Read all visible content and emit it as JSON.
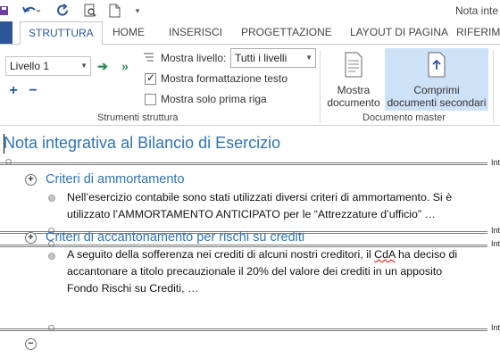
{
  "qat": {
    "doc_title": "Nota inte"
  },
  "tabs": [
    {
      "label": "STRUTTURA",
      "active": true
    },
    {
      "label": "HOME"
    },
    {
      "label": "INSERISCI"
    },
    {
      "label": "PROGETTAZIONE"
    },
    {
      "label": "LAYOUT DI PAGINA"
    },
    {
      "label": "RIFERIM"
    }
  ],
  "ribbon": {
    "outline_tools": {
      "level_value": "Livello 1",
      "show_level_label": "Mostra livello:",
      "show_level_value": "Tutti i livelli",
      "show_text_formatting_label": "Mostra formattazione testo",
      "show_text_formatting_checked": true,
      "show_first_line_label": "Mostra solo prima riga",
      "show_first_line_checked": false,
      "group_label": "Strumenti struttura"
    },
    "master_document": {
      "show_document_line1": "Mostra",
      "show_document_line2": "documento",
      "collapse_subdocs_line1": "Comprimi",
      "collapse_subdocs_line2": "documenti secondari",
      "group_label": "Documento master"
    }
  },
  "document": {
    "title": "Nota integrativa al Bilancio di Esercizio",
    "section_break_label": "Int",
    "sections": [
      {
        "heading": "Criteri di ammortamento",
        "body_line1": "Nell’esercizio contabile sono stati utilizzati diversi criteri di ammortamento. Si è",
        "body_line2": "utilizzato l’AMMORTAMENTO ANTICIPATO per le “Attrezzature d’ufficio” …"
      },
      {
        "heading": "Criteri di accantonamento per rischi su crediti",
        "body_line1_a": "A seguito della sofferenza nei crediti di alcuni nostri creditori, il ",
        "body_line1_b": "CdA",
        "body_line1_c": " ha deciso di",
        "body_line2": "accantonare a titolo precauzionale il 20% del valore dei crediti in un apposito",
        "body_line3": "Fondo Rischi su Crediti, …"
      }
    ]
  },
  "colors": {
    "accent": "#2b579a",
    "heading": "#2e74b5",
    "highlight": "#cde1f7"
  }
}
